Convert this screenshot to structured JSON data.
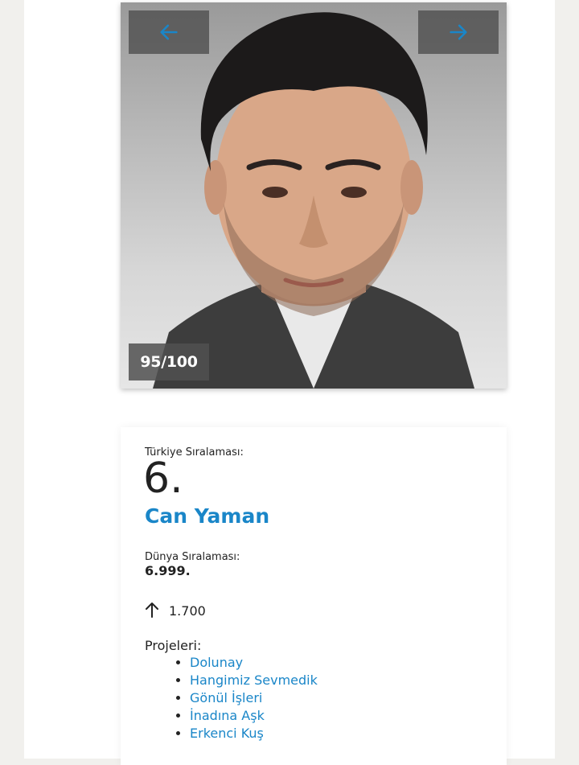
{
  "slider": {
    "prev_icon": "arrow-left-icon",
    "next_icon": "arrow-right-icon",
    "score": "95/100",
    "accent": "#1a86c8"
  },
  "profile": {
    "turkey_rank_label": "Türkiye Sıralaması:",
    "turkey_rank": "6.",
    "name": "Can Yaman",
    "world_rank_label": "Dünya Sıralaması:",
    "world_rank": "6.999.",
    "change_icon": "arrow-up-icon",
    "change_value": "1.700",
    "projects_label": "Projeleri:",
    "projects": [
      {
        "title": "Dolunay"
      },
      {
        "title": "Hangimiz Sevmedik"
      },
      {
        "title": "Gönül İşleri"
      },
      {
        "title": "İnadına Aşk"
      },
      {
        "title": "Erkenci Kuş"
      }
    ]
  }
}
